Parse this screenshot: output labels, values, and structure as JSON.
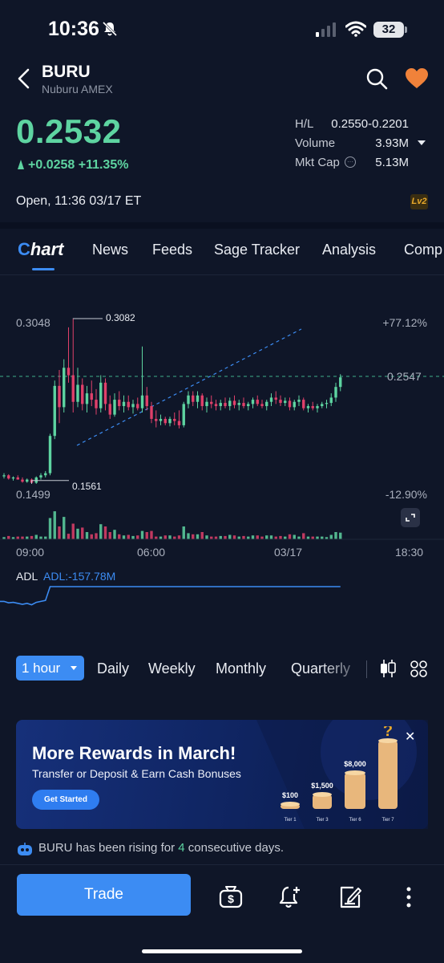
{
  "status_bar": {
    "time": "10:36",
    "battery": "32",
    "icons": [
      "bell-off-icon",
      "signal-icon",
      "wifi-icon",
      "battery-icon"
    ]
  },
  "header": {
    "ticker": "BURU",
    "subtitle": "Nuburu AMEX",
    "icons": [
      "back-chevron-icon",
      "search-icon",
      "heart-icon"
    ]
  },
  "quote": {
    "price": "0.2532",
    "change": "+0.0258 +11.35%",
    "stats": [
      {
        "label": "H/L",
        "value": "0.2550-0.2201"
      },
      {
        "label": "Volume",
        "value": "3.93M"
      },
      {
        "label": "Mkt Cap",
        "value": "5.13M"
      }
    ],
    "market_status": "Open,  11:36 03/17 ET",
    "lv2_badge": "Lv2"
  },
  "tabs": [
    "Chart",
    "News",
    "Feeds",
    "Sage Tracker",
    "Analysis",
    "Comp"
  ],
  "chart": {
    "price_labels": {
      "high": "0.3048",
      "low": "0.1499",
      "current": "0.2547"
    },
    "pct_labels": {
      "top": "+77.12%",
      "bottom": "-12.90%"
    },
    "annotations": {
      "max": "0.3082",
      "min": "0.1561"
    },
    "x_labels": [
      "09:00",
      "06:00",
      "03/17",
      "18:30"
    ],
    "adl_label": "ADL",
    "adl_value": "ADL:-157.78M"
  },
  "chart_data": {
    "type": "candlestick",
    "title": "",
    "y_range": [
      0.1499,
      0.3082
    ],
    "reference_price": 0.2547,
    "max_annotation": 0.3082,
    "min_annotation": 0.1561,
    "x_tick_labels": [
      "09:00",
      "06:00",
      "03/17",
      "18:30"
    ],
    "pct_range": [
      "+77.12%",
      "-12.90%"
    ],
    "indicator": {
      "name": "ADL",
      "value": "-157.78M"
    },
    "series": [
      {
        "name": "",
        "ohlc": [
          [
            0.16,
            0.163,
            0.158,
            0.161
          ],
          [
            0.161,
            0.162,
            0.157,
            0.158
          ],
          [
            0.158,
            0.16,
            0.156,
            0.159
          ],
          [
            0.159,
            0.161,
            0.157,
            0.157
          ],
          [
            0.157,
            0.159,
            0.154,
            0.155
          ],
          [
            0.155,
            0.158,
            0.154,
            0.157
          ],
          [
            0.157,
            0.158,
            0.153,
            0.154
          ],
          [
            0.154,
            0.16,
            0.153,
            0.159
          ],
          [
            0.159,
            0.163,
            0.157,
            0.161
          ],
          [
            0.161,
            0.165,
            0.159,
            0.163
          ],
          [
            0.163,
            0.2,
            0.161,
            0.198
          ],
          [
            0.198,
            0.25,
            0.195,
            0.245
          ],
          [
            0.245,
            0.26,
            0.21,
            0.225
          ],
          [
            0.225,
            0.27,
            0.22,
            0.262
          ],
          [
            0.262,
            0.3,
            0.248,
            0.255
          ],
          [
            0.255,
            0.308,
            0.22,
            0.23
          ],
          [
            0.23,
            0.262,
            0.225,
            0.246
          ],
          [
            0.246,
            0.252,
            0.222,
            0.228
          ],
          [
            0.228,
            0.245,
            0.22,
            0.238
          ],
          [
            0.238,
            0.25,
            0.226,
            0.232
          ],
          [
            0.232,
            0.242,
            0.218,
            0.224
          ],
          [
            0.224,
            0.255,
            0.22,
            0.248
          ],
          [
            0.248,
            0.252,
            0.222,
            0.228
          ],
          [
            0.228,
            0.236,
            0.214,
            0.218
          ],
          [
            0.218,
            0.238,
            0.216,
            0.232
          ],
          [
            0.232,
            0.24,
            0.222,
            0.226
          ],
          [
            0.226,
            0.236,
            0.22,
            0.23
          ],
          [
            0.23,
            0.236,
            0.222,
            0.225
          ],
          [
            0.225,
            0.232,
            0.219,
            0.228
          ],
          [
            0.228,
            0.234,
            0.222,
            0.224
          ],
          [
            0.224,
            0.282,
            0.22,
            0.236
          ],
          [
            0.236,
            0.244,
            0.222,
            0.226
          ],
          [
            0.226,
            0.23,
            0.21,
            0.214
          ],
          [
            0.214,
            0.222,
            0.206,
            0.212
          ],
          [
            0.212,
            0.218,
            0.208,
            0.214
          ],
          [
            0.214,
            0.216,
            0.208,
            0.21
          ],
          [
            0.21,
            0.216,
            0.207,
            0.214
          ],
          [
            0.214,
            0.22,
            0.208,
            0.212
          ],
          [
            0.212,
            0.222,
            0.205,
            0.208
          ],
          [
            0.208,
            0.23,
            0.206,
            0.228
          ],
          [
            0.228,
            0.24,
            0.224,
            0.236
          ],
          [
            0.236,
            0.24,
            0.226,
            0.23
          ],
          [
            0.23,
            0.24,
            0.224,
            0.236
          ],
          [
            0.236,
            0.238,
            0.222,
            0.226
          ],
          [
            0.226,
            0.234,
            0.22,
            0.23
          ],
          [
            0.23,
            0.236,
            0.224,
            0.228
          ],
          [
            0.228,
            0.232,
            0.222,
            0.226
          ],
          [
            0.226,
            0.232,
            0.222,
            0.229
          ],
          [
            0.229,
            0.234,
            0.224,
            0.226
          ],
          [
            0.226,
            0.234,
            0.222,
            0.231
          ],
          [
            0.231,
            0.236,
            0.224,
            0.227
          ],
          [
            0.227,
            0.232,
            0.222,
            0.229
          ],
          [
            0.229,
            0.234,
            0.224,
            0.226
          ],
          [
            0.226,
            0.23,
            0.222,
            0.228
          ],
          [
            0.228,
            0.234,
            0.224,
            0.232
          ],
          [
            0.232,
            0.236,
            0.226,
            0.228
          ],
          [
            0.228,
            0.232,
            0.224,
            0.226
          ],
          [
            0.226,
            0.232,
            0.222,
            0.23
          ],
          [
            0.23,
            0.238,
            0.226,
            0.234
          ],
          [
            0.234,
            0.24,
            0.228,
            0.232
          ],
          [
            0.232,
            0.236,
            0.226,
            0.229
          ],
          [
            0.229,
            0.234,
            0.226,
            0.231
          ],
          [
            0.231,
            0.234,
            0.222,
            0.225
          ],
          [
            0.225,
            0.232,
            0.222,
            0.23
          ],
          [
            0.23,
            0.236,
            0.226,
            0.232
          ],
          [
            0.232,
            0.234,
            0.222,
            0.224
          ],
          [
            0.224,
            0.228,
            0.22,
            0.226
          ],
          [
            0.226,
            0.23,
            0.222,
            0.224
          ],
          [
            0.224,
            0.228,
            0.22,
            0.226
          ],
          [
            0.226,
            0.23,
            0.224,
            0.228
          ],
          [
            0.228,
            0.232,
            0.224,
            0.229
          ],
          [
            0.229,
            0.238,
            0.226,
            0.234
          ],
          [
            0.234,
            0.248,
            0.23,
            0.244
          ],
          [
            0.244,
            0.256,
            0.24,
            0.253
          ]
        ]
      }
    ]
  },
  "periods": [
    "1 hour",
    "Daily",
    "Weekly",
    "Monthly",
    "Quarterly"
  ],
  "period_icons": [
    "candlestick-icon",
    "grid-icon"
  ],
  "banner": {
    "title": "More Rewards in March!",
    "subtitle": "Transfer or Deposit & Earn Cash Bonuses",
    "button": "Get Started",
    "tiers": [
      {
        "price": "$100",
        "label": "Tier 1",
        "level": 0.06
      },
      {
        "price": "$1,500",
        "label": "Tier 3",
        "level": 0.18
      },
      {
        "price": "$8,000",
        "label": "Tier 6",
        "level": 0.45
      },
      {
        "price": "?",
        "label": "Tier 7",
        "level": 0.85
      }
    ]
  },
  "rising_text": {
    "pre": "BURU has been rising for ",
    "num": "4",
    "post": " consecutive days."
  },
  "bottom_bar": {
    "trade": "Trade",
    "icons": [
      "money-bag-icon",
      "bell-plus-icon",
      "edit-note-icon",
      "more-vertical-icon"
    ]
  },
  "colors": {
    "up": "#5ed4a1",
    "down": "#e0406a",
    "accent": "#3c8cf3",
    "bg": "#0f1628"
  }
}
